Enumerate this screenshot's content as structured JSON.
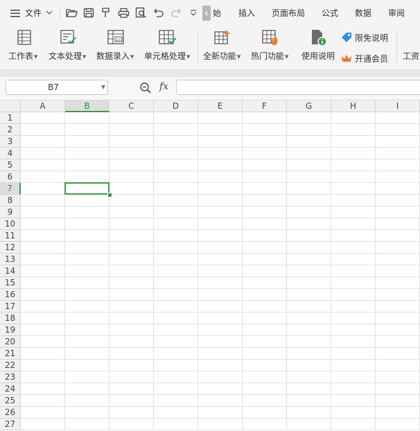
{
  "menubar": {
    "menu_label": "文件",
    "tabs": [
      "始",
      "插入",
      "页面布局",
      "公式",
      "数据",
      "审阅"
    ]
  },
  "ribbon": {
    "worksheet": "工作表",
    "text_processing": "文本处理",
    "data_entry": "数据录入",
    "cell_processing": "单元格处理",
    "new_features": "全新功能",
    "hot_features": "热门功能",
    "usage_guide": "使用说明",
    "free_explain": "限免说明",
    "membership": "开通会员",
    "cut_off": "工资"
  },
  "formula_bar": {
    "name_box": "B7",
    "fx": "fx",
    "formula_value": ""
  },
  "sheet": {
    "columns": [
      "A",
      "B",
      "C",
      "D",
      "E",
      "F",
      "G",
      "H",
      "I"
    ],
    "rows": [
      "1",
      "2",
      "3",
      "4",
      "5",
      "6",
      "7",
      "8",
      "9",
      "10",
      "11",
      "12",
      "13",
      "14",
      "15",
      "16",
      "17",
      "18",
      "19",
      "20",
      "21",
      "22",
      "23",
      "24",
      "25",
      "26",
      "27"
    ],
    "active_column": "B",
    "active_row": "7"
  },
  "colors": {
    "accent_green": "#3d9a47",
    "ribbon_bg": "#f4f4f4",
    "orange": "#f07a2a",
    "blue": "#3b8ee6"
  }
}
